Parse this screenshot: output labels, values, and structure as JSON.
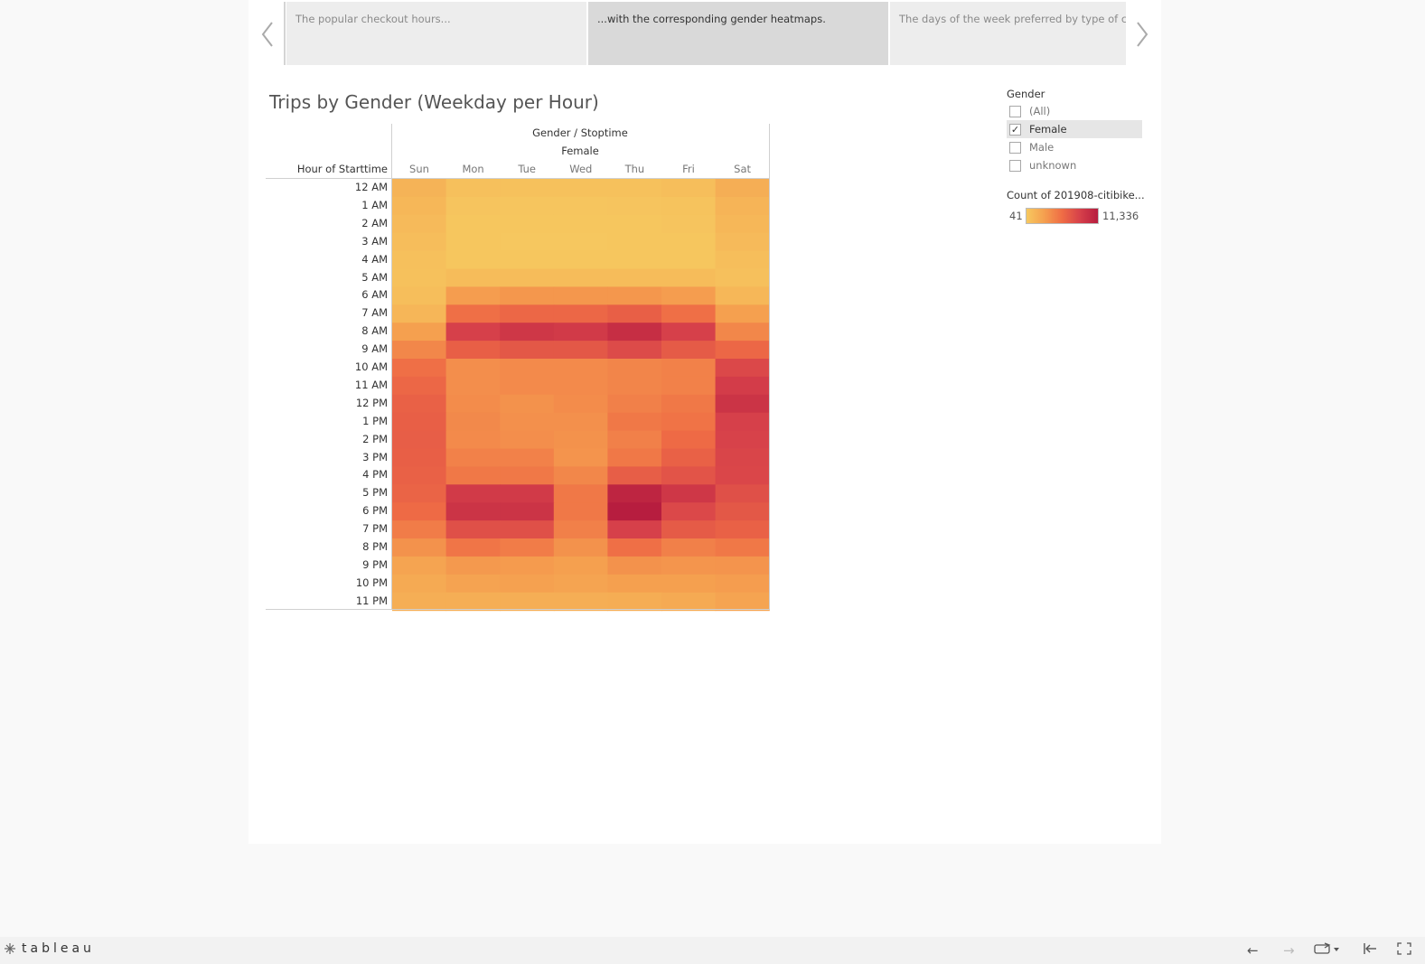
{
  "story": {
    "points": [
      "The popular checkout hours...",
      "...with the corresponding gender heatmaps.",
      "The days of the week preferred by type of customer"
    ],
    "active_index": 1
  },
  "sheet": {
    "title": "Trips by Gender (Weekday per Hour)",
    "column_header": "Gender / Stoptime",
    "gender_header": "Female",
    "row_header": "Hour of Starttime"
  },
  "filter": {
    "title": "Gender",
    "items": [
      {
        "label": "(All)",
        "checked": false
      },
      {
        "label": "Female",
        "checked": true
      },
      {
        "label": "Male",
        "checked": false
      },
      {
        "label": "unknown",
        "checked": false
      }
    ]
  },
  "legend": {
    "title": "Count of 201908-citibike...",
    "min_label": "41",
    "max_label": "11,336",
    "colors": [
      "#f6c85f",
      "#f59f4f",
      "#ef6c45",
      "#d6404a",
      "#b71d3f"
    ]
  },
  "chart_data": {
    "type": "heatmap",
    "title": "Trips by Gender (Weekday per Hour)",
    "xlabel": "Gender / Stoptime",
    "ylabel": "Hour of Starttime",
    "columns": [
      "Sun",
      "Mon",
      "Tue",
      "Wed",
      "Thu",
      "Fri",
      "Sat"
    ],
    "rows": [
      "12 AM",
      "1 AM",
      "2 AM",
      "3 AM",
      "4 AM",
      "5 AM",
      "6 AM",
      "7 AM",
      "8 AM",
      "9 AM",
      "10 AM",
      "11 AM",
      "12 PM",
      "1 PM",
      "2 PM",
      "3 PM",
      "4 PM",
      "5 PM",
      "6 PM",
      "7 PM",
      "8 PM",
      "9 PM",
      "10 PM",
      "11 PM"
    ],
    "color_range": [
      41,
      11336
    ],
    "values": [
      [
        1500,
        600,
        500,
        500,
        500,
        700,
        1800
      ],
      [
        1200,
        300,
        250,
        250,
        300,
        400,
        1400
      ],
      [
        1000,
        200,
        150,
        150,
        200,
        300,
        1200
      ],
      [
        800,
        150,
        100,
        100,
        150,
        200,
        1000
      ],
      [
        600,
        200,
        150,
        150,
        200,
        200,
        700
      ],
      [
        500,
        900,
        900,
        900,
        900,
        900,
        600
      ],
      [
        700,
        3000,
        3300,
        3300,
        3300,
        3000,
        1200
      ],
      [
        1300,
        5500,
        6000,
        6000,
        6500,
        5500,
        2800
      ],
      [
        2800,
        8500,
        9200,
        9000,
        10000,
        8500,
        4200
      ],
      [
        4200,
        6500,
        7000,
        7000,
        7800,
        6800,
        6000
      ],
      [
        5500,
        3800,
        4000,
        4000,
        4300,
        4500,
        8000
      ],
      [
        6000,
        3800,
        4000,
        4000,
        4300,
        4500,
        8800
      ],
      [
        6400,
        3900,
        3600,
        3900,
        4600,
        5000,
        9500
      ],
      [
        6500,
        4100,
        3700,
        3700,
        5000,
        5300,
        8500
      ],
      [
        6600,
        4000,
        3800,
        3600,
        4600,
        5800,
        8400
      ],
      [
        6500,
        4500,
        4500,
        3500,
        5000,
        6400,
        8200
      ],
      [
        6400,
        5000,
        5000,
        4200,
        6600,
        7200,
        8100
      ],
      [
        6200,
        9000,
        9000,
        5000,
        10700,
        9200,
        7500
      ],
      [
        5800,
        9500,
        9500,
        5000,
        11336,
        8000,
        7000
      ],
      [
        4800,
        7500,
        7500,
        4600,
        8500,
        6800,
        6400
      ],
      [
        3600,
        5200,
        4800,
        3600,
        5500,
        4600,
        5000
      ],
      [
        2500,
        3200,
        3100,
        2800,
        3600,
        3400,
        3500
      ],
      [
        2100,
        2600,
        2700,
        2500,
        2800,
        2800,
        3000
      ],
      [
        1800,
        1800,
        1800,
        1800,
        1900,
        2100,
        2500
      ]
    ]
  },
  "toolbar": {
    "logo": "tableau",
    "icons": [
      "undo-icon",
      "redo-icon",
      "share-icon",
      "revert-icon",
      "fullscreen-icon"
    ]
  }
}
